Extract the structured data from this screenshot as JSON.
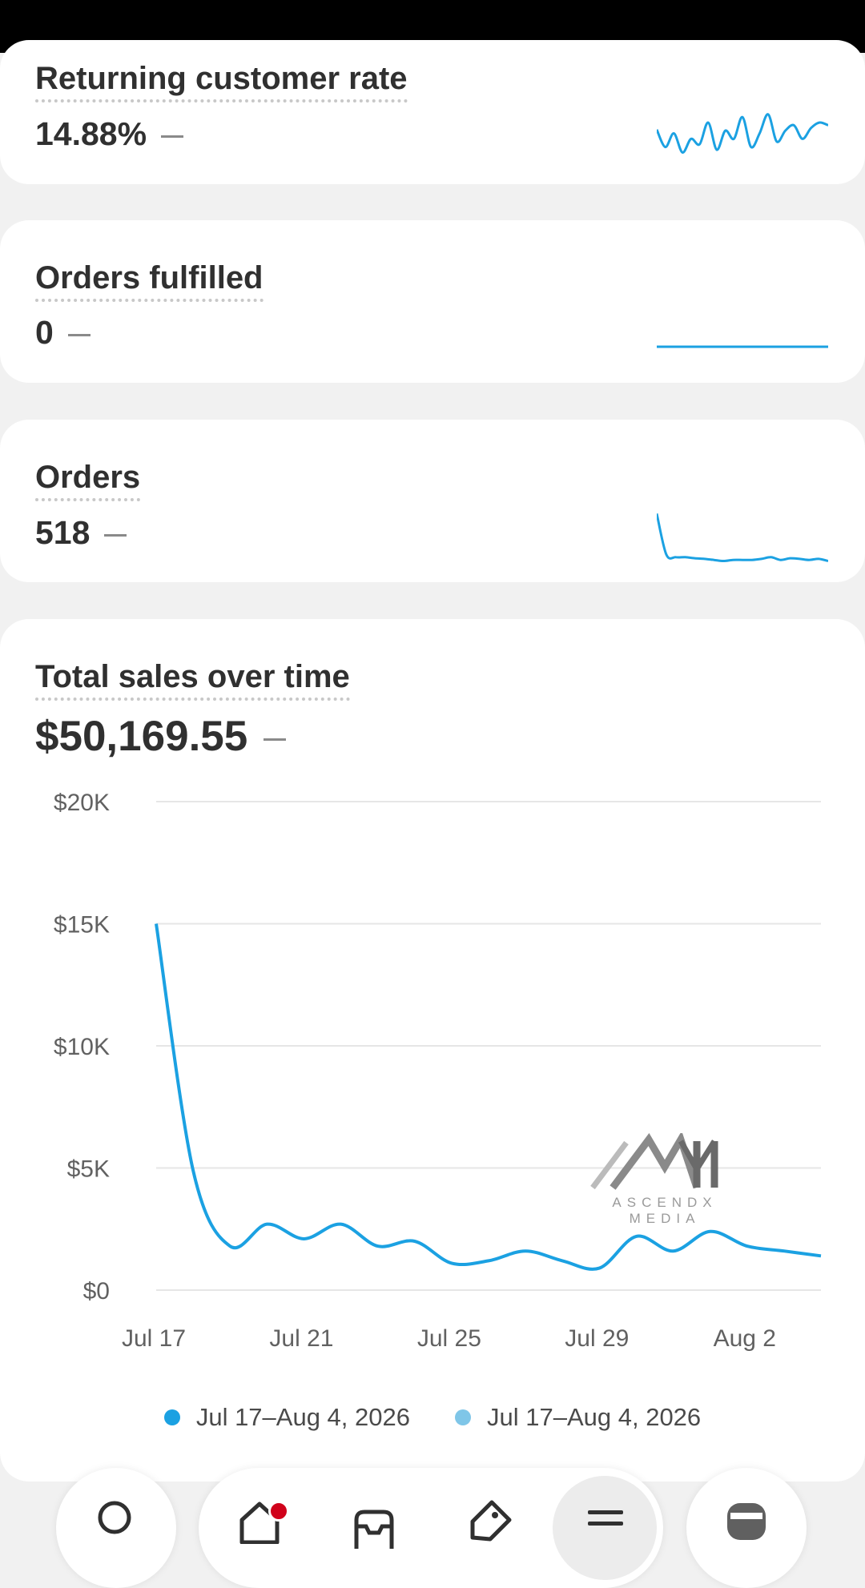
{
  "cards": {
    "returning": {
      "title": "Returning customer rate",
      "value": "14.88%",
      "trend": [
        0.62,
        0.3,
        0.55,
        0.2,
        0.45,
        0.35,
        0.75,
        0.25,
        0.6,
        0.45,
        0.85,
        0.3,
        0.55,
        0.9,
        0.4,
        0.6,
        0.7,
        0.45,
        0.65,
        0.75,
        0.7
      ]
    },
    "fulfilled": {
      "title": "Orders fulfilled",
      "value": "0",
      "trend": [
        0,
        0,
        0,
        0,
        0,
        0,
        0,
        0,
        0,
        0,
        0,
        0,
        0,
        0,
        0,
        0,
        0,
        0,
        0
      ]
    },
    "orders": {
      "title": "Orders",
      "value": "518",
      "trend": [
        0.95,
        0.2,
        0.15,
        0.15,
        0.13,
        0.12,
        0.1,
        0.08,
        0.1,
        0.1,
        0.1,
        0.12,
        0.15,
        0.1,
        0.13,
        0.12,
        0.1,
        0.12,
        0.08
      ]
    },
    "sales": {
      "title": "Total sales over time",
      "value": "$50,169.55"
    }
  },
  "chart_data": {
    "type": "line",
    "title": "Total sales over time",
    "x": [
      "Jul 17",
      "Jul 18",
      "Jul 19",
      "Jul 20",
      "Jul 21",
      "Jul 22",
      "Jul 23",
      "Jul 24",
      "Jul 25",
      "Jul 26",
      "Jul 27",
      "Jul 28",
      "Jul 29",
      "Jul 30",
      "Jul 31",
      "Aug 1",
      "Aug 2",
      "Aug 3",
      "Aug 4"
    ],
    "x_tick_labels": [
      "Jul 17",
      "Jul 21",
      "Jul 25",
      "Jul 29",
      "Aug 2"
    ],
    "x_tick_indices": [
      0,
      4,
      8,
      12,
      16
    ],
    "y_tick_labels": [
      "$0",
      "$5K",
      "$10K",
      "$15K",
      "$20K"
    ],
    "y_tick_values": [
      0,
      5000,
      10000,
      15000,
      20000
    ],
    "ylim": [
      0,
      20000
    ],
    "grid": true,
    "series": [
      {
        "name": "Jul 17–Aug 4, 2026",
        "color": "#1ba1e2",
        "values": [
          15000,
          4900,
          1800,
          2700,
          2100,
          2700,
          1800,
          2000,
          1100,
          1200,
          1600,
          1200,
          900,
          2200,
          1600,
          2400,
          1800,
          1600,
          1400
        ]
      }
    ],
    "legend": [
      {
        "label": "Jul 17–Aug 4, 2026",
        "color": "#1ba1e2"
      },
      {
        "label": "Jul 17–Aug 4, 2026",
        "color": "#7fc6e8"
      }
    ]
  },
  "watermark": {
    "text": "ASCENDX MEDIA"
  },
  "nav": {
    "items": [
      "search-icon",
      "home-icon",
      "inbox-icon",
      "tag-icon",
      "menu-icon",
      "avatar-icon"
    ]
  }
}
